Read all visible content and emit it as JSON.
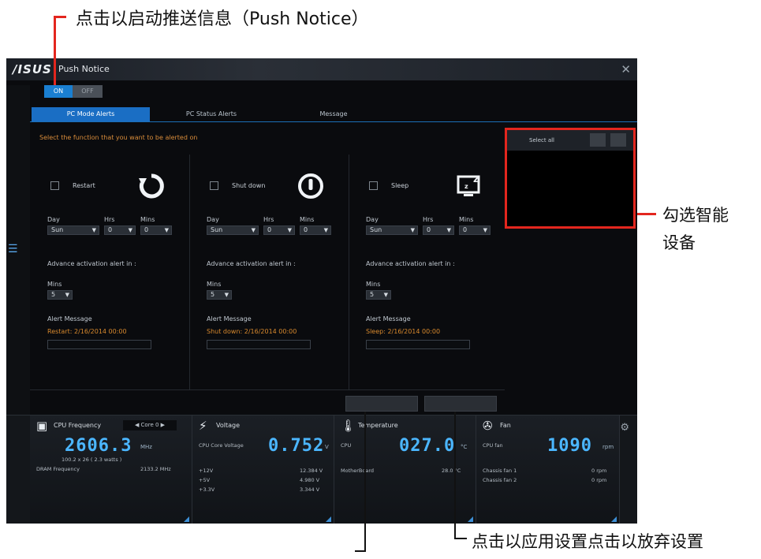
{
  "annotations": {
    "top": "点击以启动推送信息（Push Notice）",
    "right_line1": "勾选智能",
    "right_line2": "设备",
    "bottom": "点击以应用设置点击以放弃设置"
  },
  "window": {
    "brand": "/ISUS",
    "title": "Push Notice",
    "close_icon": "close-icon"
  },
  "toggle": {
    "on": "ON",
    "off": "OFF"
  },
  "tabs": [
    {
      "label": "PC Mode Alerts",
      "active": true
    },
    {
      "label": "PC Status Alerts",
      "active": false
    },
    {
      "label": "Message",
      "active": false
    }
  ],
  "instruction": "Select the function that you want to be alerted on",
  "columns": [
    {
      "check_label": "Restart",
      "icon": "restart-icon",
      "day_label": "Day",
      "hrs_label": "Hrs",
      "mins_label": "Mins",
      "day": "Sun",
      "hrs": "0",
      "mins": "0",
      "advance_label": "Advance activation alert in :",
      "adv_mins_label": "Mins",
      "adv_mins": "5",
      "alert_label": "Alert Message",
      "alert_msg": "Restart: 2/16/2014 00:00"
    },
    {
      "check_label": "Shut down",
      "icon": "power-icon",
      "day_label": "Day",
      "hrs_label": "Hrs",
      "mins_label": "Mins",
      "day": "Sun",
      "hrs": "0",
      "mins": "0",
      "advance_label": "Advance activation alert in :",
      "adv_mins_label": "Mins",
      "adv_mins": "5",
      "alert_label": "Alert Message",
      "alert_msg": "Shut down: 2/16/2014 00:00"
    },
    {
      "check_label": "Sleep",
      "icon": "sleep-icon",
      "day_label": "Day",
      "hrs_label": "Hrs",
      "mins_label": "Mins",
      "day": "Sun",
      "hrs": "0",
      "mins": "0",
      "advance_label": "Advance activation alert in :",
      "adv_mins_label": "Mins",
      "adv_mins": "5",
      "alert_label": "Alert Message",
      "alert_msg": "Sleep: 2/16/2014 00:00"
    }
  ],
  "device_panel": {
    "select_all": "Select all",
    "edit_icon": "edit-icon",
    "delete_icon": "trash-icon"
  },
  "monitor": {
    "cpu": {
      "title": "CPU Frequency",
      "core": "Core 0",
      "value": "2606.3",
      "unit": "MHz",
      "sub": "100.2 x 26 ( 2.3  watts )",
      "dram_label": "DRAM Frequency",
      "dram": "2133.2 MHz"
    },
    "voltage": {
      "title": "Voltage",
      "label": "CPU Core Voltage",
      "value": "0.752",
      "unit": "V",
      "rows": [
        {
          "k": "+12V",
          "v": "12.384 V"
        },
        {
          "k": "+5V",
          "v": "4.980 V"
        },
        {
          "k": "+3.3V",
          "v": "3.344 V"
        }
      ]
    },
    "temp": {
      "title": "Temperature",
      "label": "CPU",
      "value": "027.0",
      "unit": "°C",
      "row_k": "MotherBoard",
      "row_v": "28.0 °C"
    },
    "fan": {
      "title": "Fan",
      "label": "CPU fan",
      "value": "1090",
      "unit": "rpm",
      "rows": [
        {
          "k": "Chassis fan 1",
          "v": "0 rpm"
        },
        {
          "k": "Chassis fan 2",
          "v": "0 rpm"
        }
      ]
    }
  }
}
